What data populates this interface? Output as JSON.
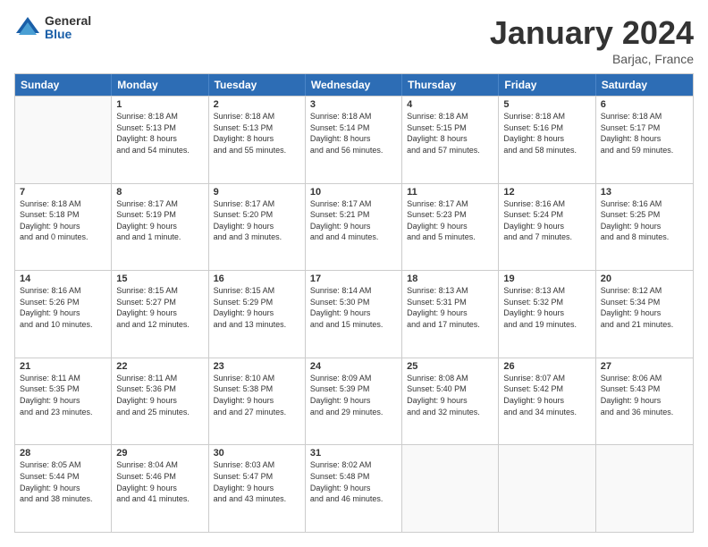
{
  "header": {
    "logo_general": "General",
    "logo_blue": "Blue",
    "month_title": "January 2024",
    "location": "Barjac, France"
  },
  "days_of_week": [
    "Sunday",
    "Monday",
    "Tuesday",
    "Wednesday",
    "Thursday",
    "Friday",
    "Saturday"
  ],
  "weeks": [
    [
      {
        "day": "",
        "sunrise": "",
        "sunset": "",
        "daylight": "",
        "empty": true
      },
      {
        "day": "1",
        "sunrise": "Sunrise: 8:18 AM",
        "sunset": "Sunset: 5:13 PM",
        "daylight": "Daylight: 8 hours and 54 minutes."
      },
      {
        "day": "2",
        "sunrise": "Sunrise: 8:18 AM",
        "sunset": "Sunset: 5:13 PM",
        "daylight": "Daylight: 8 hours and 55 minutes."
      },
      {
        "day": "3",
        "sunrise": "Sunrise: 8:18 AM",
        "sunset": "Sunset: 5:14 PM",
        "daylight": "Daylight: 8 hours and 56 minutes."
      },
      {
        "day": "4",
        "sunrise": "Sunrise: 8:18 AM",
        "sunset": "Sunset: 5:15 PM",
        "daylight": "Daylight: 8 hours and 57 minutes."
      },
      {
        "day": "5",
        "sunrise": "Sunrise: 8:18 AM",
        "sunset": "Sunset: 5:16 PM",
        "daylight": "Daylight: 8 hours and 58 minutes."
      },
      {
        "day": "6",
        "sunrise": "Sunrise: 8:18 AM",
        "sunset": "Sunset: 5:17 PM",
        "daylight": "Daylight: 8 hours and 59 minutes."
      }
    ],
    [
      {
        "day": "7",
        "sunrise": "Sunrise: 8:18 AM",
        "sunset": "Sunset: 5:18 PM",
        "daylight": "Daylight: 9 hours and 0 minutes."
      },
      {
        "day": "8",
        "sunrise": "Sunrise: 8:17 AM",
        "sunset": "Sunset: 5:19 PM",
        "daylight": "Daylight: 9 hours and 1 minute."
      },
      {
        "day": "9",
        "sunrise": "Sunrise: 8:17 AM",
        "sunset": "Sunset: 5:20 PM",
        "daylight": "Daylight: 9 hours and 3 minutes."
      },
      {
        "day": "10",
        "sunrise": "Sunrise: 8:17 AM",
        "sunset": "Sunset: 5:21 PM",
        "daylight": "Daylight: 9 hours and 4 minutes."
      },
      {
        "day": "11",
        "sunrise": "Sunrise: 8:17 AM",
        "sunset": "Sunset: 5:23 PM",
        "daylight": "Daylight: 9 hours and 5 minutes."
      },
      {
        "day": "12",
        "sunrise": "Sunrise: 8:16 AM",
        "sunset": "Sunset: 5:24 PM",
        "daylight": "Daylight: 9 hours and 7 minutes."
      },
      {
        "day": "13",
        "sunrise": "Sunrise: 8:16 AM",
        "sunset": "Sunset: 5:25 PM",
        "daylight": "Daylight: 9 hours and 8 minutes."
      }
    ],
    [
      {
        "day": "14",
        "sunrise": "Sunrise: 8:16 AM",
        "sunset": "Sunset: 5:26 PM",
        "daylight": "Daylight: 9 hours and 10 minutes."
      },
      {
        "day": "15",
        "sunrise": "Sunrise: 8:15 AM",
        "sunset": "Sunset: 5:27 PM",
        "daylight": "Daylight: 9 hours and 12 minutes."
      },
      {
        "day": "16",
        "sunrise": "Sunrise: 8:15 AM",
        "sunset": "Sunset: 5:29 PM",
        "daylight": "Daylight: 9 hours and 13 minutes."
      },
      {
        "day": "17",
        "sunrise": "Sunrise: 8:14 AM",
        "sunset": "Sunset: 5:30 PM",
        "daylight": "Daylight: 9 hours and 15 minutes."
      },
      {
        "day": "18",
        "sunrise": "Sunrise: 8:13 AM",
        "sunset": "Sunset: 5:31 PM",
        "daylight": "Daylight: 9 hours and 17 minutes."
      },
      {
        "day": "19",
        "sunrise": "Sunrise: 8:13 AM",
        "sunset": "Sunset: 5:32 PM",
        "daylight": "Daylight: 9 hours and 19 minutes."
      },
      {
        "day": "20",
        "sunrise": "Sunrise: 8:12 AM",
        "sunset": "Sunset: 5:34 PM",
        "daylight": "Daylight: 9 hours and 21 minutes."
      }
    ],
    [
      {
        "day": "21",
        "sunrise": "Sunrise: 8:11 AM",
        "sunset": "Sunset: 5:35 PM",
        "daylight": "Daylight: 9 hours and 23 minutes."
      },
      {
        "day": "22",
        "sunrise": "Sunrise: 8:11 AM",
        "sunset": "Sunset: 5:36 PM",
        "daylight": "Daylight: 9 hours and 25 minutes."
      },
      {
        "day": "23",
        "sunrise": "Sunrise: 8:10 AM",
        "sunset": "Sunset: 5:38 PM",
        "daylight": "Daylight: 9 hours and 27 minutes."
      },
      {
        "day": "24",
        "sunrise": "Sunrise: 8:09 AM",
        "sunset": "Sunset: 5:39 PM",
        "daylight": "Daylight: 9 hours and 29 minutes."
      },
      {
        "day": "25",
        "sunrise": "Sunrise: 8:08 AM",
        "sunset": "Sunset: 5:40 PM",
        "daylight": "Daylight: 9 hours and 32 minutes."
      },
      {
        "day": "26",
        "sunrise": "Sunrise: 8:07 AM",
        "sunset": "Sunset: 5:42 PM",
        "daylight": "Daylight: 9 hours and 34 minutes."
      },
      {
        "day": "27",
        "sunrise": "Sunrise: 8:06 AM",
        "sunset": "Sunset: 5:43 PM",
        "daylight": "Daylight: 9 hours and 36 minutes."
      }
    ],
    [
      {
        "day": "28",
        "sunrise": "Sunrise: 8:05 AM",
        "sunset": "Sunset: 5:44 PM",
        "daylight": "Daylight: 9 hours and 38 minutes."
      },
      {
        "day": "29",
        "sunrise": "Sunrise: 8:04 AM",
        "sunset": "Sunset: 5:46 PM",
        "daylight": "Daylight: 9 hours and 41 minutes."
      },
      {
        "day": "30",
        "sunrise": "Sunrise: 8:03 AM",
        "sunset": "Sunset: 5:47 PM",
        "daylight": "Daylight: 9 hours and 43 minutes."
      },
      {
        "day": "31",
        "sunrise": "Sunrise: 8:02 AM",
        "sunset": "Sunset: 5:48 PM",
        "daylight": "Daylight: 9 hours and 46 minutes."
      },
      {
        "day": "",
        "sunrise": "",
        "sunset": "",
        "daylight": "",
        "empty": true
      },
      {
        "day": "",
        "sunrise": "",
        "sunset": "",
        "daylight": "",
        "empty": true
      },
      {
        "day": "",
        "sunrise": "",
        "sunset": "",
        "daylight": "",
        "empty": true
      }
    ]
  ]
}
